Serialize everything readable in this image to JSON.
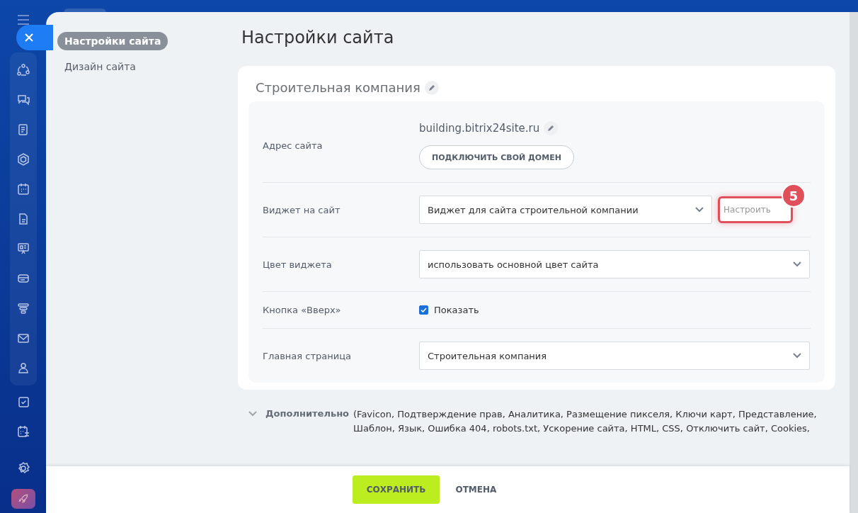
{
  "menu": [
    {
      "label": "Настройки сайта",
      "selected": true
    },
    {
      "label": "Дизайн сайта",
      "selected": false
    }
  ],
  "title": "Настройки сайта",
  "site_name": "Строительная компания",
  "fields": [
    {
      "kind": "address",
      "label": "Адрес сайта",
      "value": "building.bitrix24site.ru",
      "button": "ПОДКЛЮЧИТЬ СВОЙ ДОМЕН"
    },
    {
      "kind": "select",
      "label": "Виджет на сайт",
      "value": "Виджет для сайта строительной компании",
      "action": "Настроить",
      "callout": "5"
    },
    {
      "kind": "select",
      "label": "Цвет виджета",
      "value": "использовать основной цвет сайта"
    },
    {
      "kind": "checkbox",
      "label": "Кнопка «Вверх»",
      "option": "Показать",
      "checked": true
    },
    {
      "kind": "select",
      "label": "Главная страница",
      "value": "Строительная компания"
    }
  ],
  "more": {
    "label": "Дополнительно",
    "details": "(Favicon, Подтверждение прав, Аналитика, Размещение пикселя, Ключи карт, Представление, Шаблон, Язык, Ошибка 404, robots.txt, Ускорение сайта, HTML, CSS, Отключить сайт, Cookies,"
  },
  "footer": {
    "save": "СОХРАНИТЬ",
    "cancel": "ОТМЕНА"
  }
}
